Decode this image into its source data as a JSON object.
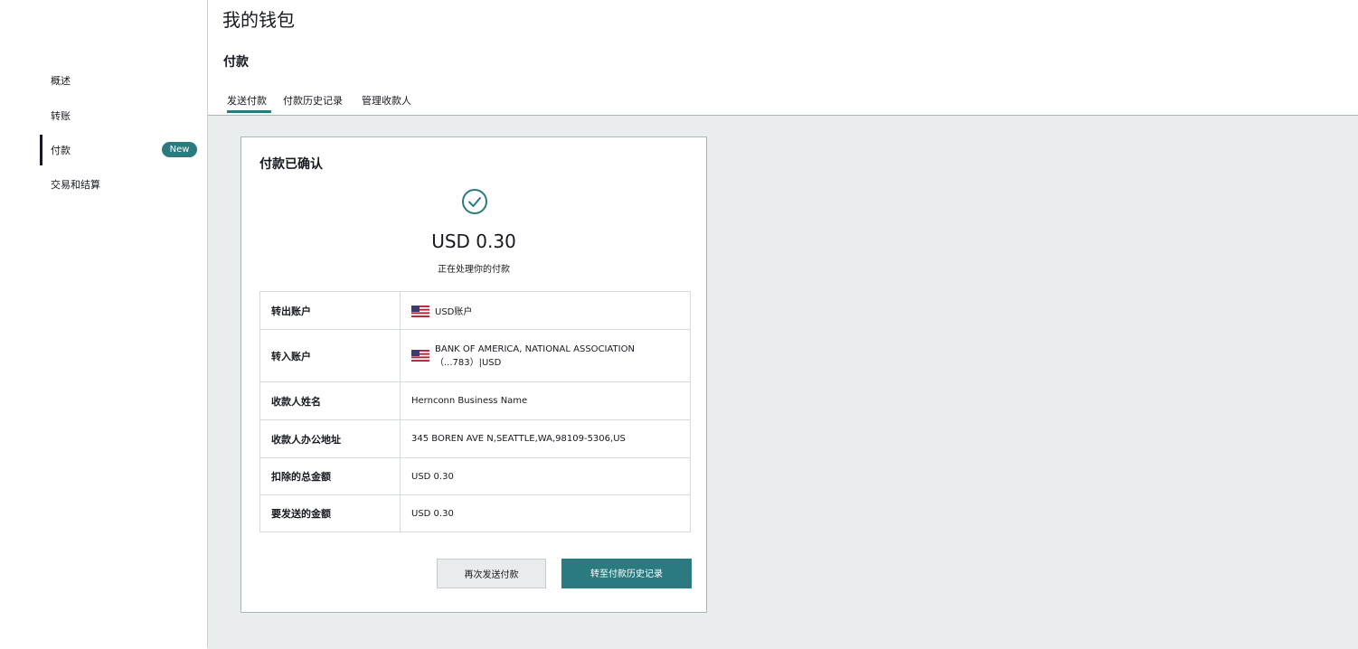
{
  "sidebar": {
    "items": [
      {
        "label": "概述"
      },
      {
        "label": "转账"
      },
      {
        "label": "付款",
        "badge": "New",
        "active": true
      },
      {
        "label": "交易和结算"
      }
    ]
  },
  "header": {
    "page_title": "我的钱包",
    "section_title": "付款",
    "tabs": [
      {
        "label": "发送付款",
        "active": true
      },
      {
        "label": "付款历史记录"
      },
      {
        "label": "管理收款人"
      }
    ]
  },
  "confirmation": {
    "title": "付款已确认",
    "icon": "check-circle-icon",
    "amount": "USD 0.30",
    "status": "正在处理你的付款",
    "rows": [
      {
        "label": "转出账户",
        "value": "USD账户",
        "flag": "us-flag-icon"
      },
      {
        "label": "转入账户",
        "value_line1": "BANK OF AMERICA, NATIONAL ASSOCIATION",
        "value_line2": "（...783）|USD",
        "flag": "us-flag-icon"
      },
      {
        "label": "收款人姓名",
        "value": "Hernconn Business Name"
      },
      {
        "label": "收款人办公地址",
        "value": "345 BOREN AVE N,SEATTLE,WA,98109-5306,US"
      },
      {
        "label": "扣除的总金额",
        "value": "USD 0.30"
      },
      {
        "label": "要发送的金额",
        "value": "USD 0.30"
      }
    ],
    "buttons": {
      "send_again": "再次发送付款",
      "go_history": "转至付款历史记录"
    }
  },
  "colors": {
    "accent": "#2a7a80",
    "background": "#eaeded"
  }
}
